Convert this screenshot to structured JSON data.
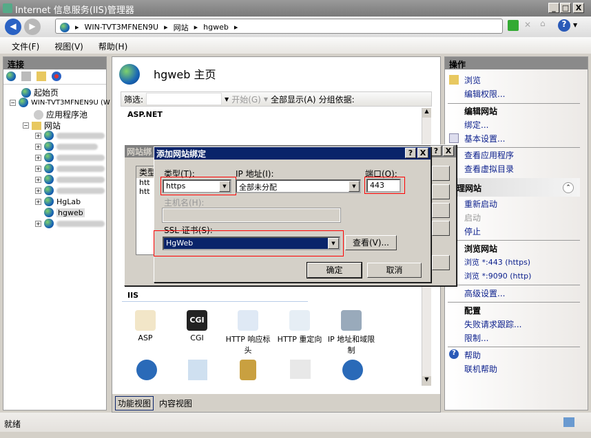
{
  "window": {
    "title": "Internet 信息服务(IIS)管理器",
    "min": "_",
    "max": "□",
    "close": "X"
  },
  "address": {
    "crumbs": [
      "WIN-TVT3MFNEN9U",
      "网站",
      "hgweb"
    ]
  },
  "menu": [
    "文件(F)",
    "视图(V)",
    "帮助(H)"
  ],
  "left": {
    "header": "连接",
    "tree": {
      "start": "起始页",
      "server": "WIN-TVT3MFNEN9U (W",
      "apppools": "应用程序池",
      "sites": "网站",
      "hglab": "HgLab",
      "hgweb": "hgweb"
    }
  },
  "center": {
    "title": "hgweb 主页",
    "filter_label": "筛选:",
    "start": "开始(G)",
    "showall": "全部显示(A)",
    "groupby": "分组依据:",
    "asp_section": "ASP.NET",
    "iis_section": "IIS",
    "iis_features": [
      "ASP",
      "CGI",
      "HTTP 响应标头",
      "HTTP 重定向",
      "IP 地址和域限制"
    ],
    "tabs": {
      "feature": "功能视图",
      "content": "内容视图"
    }
  },
  "right": {
    "header": "操作",
    "browse": "浏览",
    "edit_perm": "编辑权限...",
    "edit_site": "编辑网站",
    "bindings": "绑定...",
    "basic": "基本设置...",
    "view_apps": "查看应用程序",
    "view_vdirs": "查看虚拟目录",
    "manage_site": "理网站",
    "restart": "重新启动",
    "start": "启动",
    "stop": "停止",
    "browse_site": "浏览网站",
    "browse_443": "浏览 *:443 (https)",
    "browse_9090": "浏览 *:9090 (http)",
    "advanced": "高级设置...",
    "config": "配置",
    "failed_trace": "失败请求跟踪...",
    "limits": "限制...",
    "help": "帮助",
    "online_help": "联机帮助"
  },
  "bindings_dialog": {
    "title": "网站绑",
    "col_type": "类型",
    "rows": [
      "htt",
      "htt"
    ],
    "help": "?",
    "close": "X"
  },
  "add_dialog": {
    "title": "添加网站绑定",
    "help": "?",
    "close": "X",
    "type_label": "类型(T):",
    "type_value": "https",
    "ip_label": "IP 地址(I):",
    "ip_value": "全部未分配",
    "port_label": "端口(O):",
    "port_value": "443",
    "host_label": "主机名(H):",
    "host_value": "",
    "ssl_label": "SSL 证书(S):",
    "ssl_value": "HgWeb",
    "view": "查看(V)...",
    "ok": "确定",
    "cancel": "取消"
  },
  "status": "就绪"
}
